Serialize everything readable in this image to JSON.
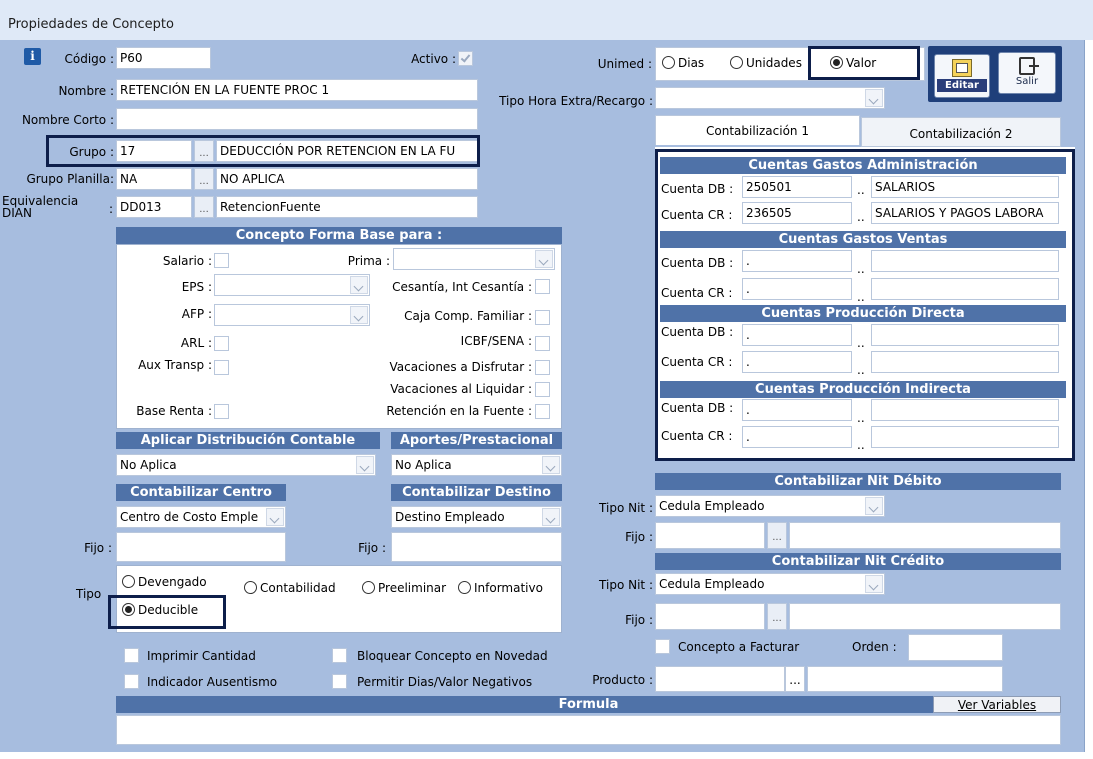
{
  "window": {
    "title": "Propiedades de Concepto"
  },
  "fields": {
    "codigo_label": "Código :",
    "codigo": "P60",
    "activo_label": "Activo :",
    "nombre_label": "Nombre :",
    "nombre": "RETENCIÓN EN LA FUENTE PROC 1",
    "nombre_corto_label": "Nombre Corto :",
    "nombre_corto": "",
    "grupo_label": "Grupo :",
    "grupo_code": "17",
    "grupo_name": "DEDUCCIÓN POR RETENCION EN LA FU",
    "grupo_planilla_label": "Grupo Planilla:",
    "grupo_planilla_code": "NA",
    "grupo_planilla_name": "NO APLICA",
    "equivalencia_label": "Equivalencia",
    "equivalencia_label2": "DIAN",
    "equivalencia_colon": ":",
    "equivalencia_code": "DD013",
    "equivalencia_name": "RetencionFuente",
    "ellipsis": "...",
    "unimed_label": "Unimed :",
    "unimed_options": [
      "Dias",
      "Unidades",
      "Valor"
    ],
    "unimed_selected": "Valor",
    "tipo_hora_label": "Tipo Hora Extra/Recargo :"
  },
  "toolbar": {
    "editar": "Editar",
    "salir": "Salir"
  },
  "tabs": [
    "Contabilización 1",
    "Contabilización 2"
  ],
  "forma_base": {
    "header": "Concepto Forma Base para :",
    "salario": "Salario :",
    "prima": "Prima :",
    "eps": "EPS :",
    "cesantia": "Cesantía, Int Cesantía :",
    "afp": "AFP :",
    "caja": "Caja Comp. Familiar :",
    "arl": "ARL :",
    "icbf": "ICBF/SENA :",
    "aux": "Aux Transp :",
    "vac_disfrutar": "Vacaciones a Disfrutar :",
    "vac_liquidar": "Vacaciones al Liquidar :",
    "base_renta": "Base Renta :",
    "retencion": "Retención en la Fuente :"
  },
  "distribucion": {
    "header": "Aplicar Distribución Contable",
    "value": "No Aplica"
  },
  "aportes": {
    "header": "Aportes/Prestacional",
    "value": "No Aplica"
  },
  "centro": {
    "header": "Contabilizar Centro",
    "value": "Centro de Costo Emple",
    "fijo_label": "Fijo :"
  },
  "destino": {
    "header": "Contabilizar Destino",
    "value": "Destino Empleado",
    "fijo_label": "Fijo :"
  },
  "tipo": {
    "label": "Tipo",
    "options": [
      "Devengado",
      "Contabilidad",
      "Preeliminar",
      "Informativo",
      "Deducible"
    ],
    "selected": "Deducible"
  },
  "checks": {
    "imprimir": "Imprimir Cantidad",
    "bloquear": "Bloquear Concepto en Novedad",
    "ausentismo": "Indicador Ausentismo",
    "permitir": "Permitir Dias/Valor Negativos"
  },
  "cuentas": {
    "admin_header": "Cuentas Gastos Administración",
    "ventas_header": "Cuentas Gastos Ventas",
    "prod_dir_header": "Cuentas Producción Directa",
    "prod_ind_header": "Cuentas Producción Indirecta",
    "db_label": "Cuenta DB :",
    "cr_label": "Cuenta CR :",
    "admin_db": "250501",
    "admin_db_name": "SALARIOS",
    "admin_cr": "236505",
    "admin_cr_name": "SALARIOS Y PAGOS LABORA",
    "dot": ".",
    "dots": ".."
  },
  "nit_debito": {
    "header": "Contabilizar Nit Débito",
    "tipo_label": "Tipo Nit :",
    "value": "Cedula Empleado",
    "fijo_label": "Fijo :"
  },
  "nit_credito": {
    "header": "Contabilizar Nit Crédito",
    "tipo_label": "Tipo Nit :",
    "value": "Cedula Empleado",
    "fijo_label": "Fijo :"
  },
  "facturar": {
    "concepto": "Concepto a Facturar",
    "orden_label": "Orden :",
    "producto_label": "Producto :"
  },
  "formula": {
    "header": "Formula",
    "ver_variables": "Ver Variables"
  }
}
